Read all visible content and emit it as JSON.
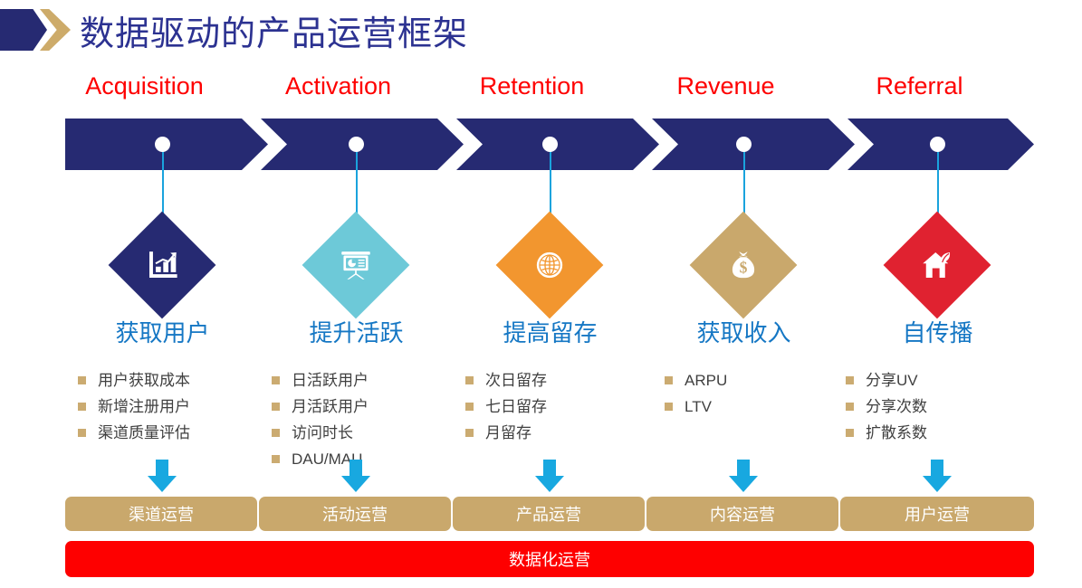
{
  "header": {
    "title": "数据驱动的产品运营框架",
    "logo_icon": "double-chevron-logo"
  },
  "colors": {
    "navy": "#262a72",
    "gold": "#c9a86c",
    "red": "#fe0000",
    "blue_text": "#1577c4",
    "cyan": "#18a8e0",
    "teal": "#6dc9d8",
    "orange": "#f2962f",
    "crimson": "#e02230"
  },
  "stages": [
    {
      "en_label": "Acquisition",
      "cn_label": "获取用户",
      "icon": "bar-chart-growth-icon",
      "diamond_color": "#262a72",
      "metrics": [
        "用户获取成本",
        "新增注册用户",
        "渠道质量评估"
      ],
      "op_box": "渠道运营"
    },
    {
      "en_label": "Activation",
      "cn_label": "提升活跃",
      "icon": "presentation-board-icon",
      "diamond_color": "#6dc9d8",
      "metrics": [
        "日活跃用户",
        "月活跃用户",
        "访问时长",
        "DAU/MAU"
      ],
      "op_box": "活动运营"
    },
    {
      "en_label": "Retention",
      "cn_label": "提高留存",
      "icon": "globe-icon",
      "diamond_color": "#f2962f",
      "metrics": [
        "次日留存",
        "七日留存",
        "月留存"
      ],
      "op_box": "产品运营"
    },
    {
      "en_label": "Revenue",
      "cn_label": "获取收入",
      "icon": "money-bag-icon",
      "diamond_color": "#c9a86c",
      "metrics": [
        "ARPU",
        "LTV"
      ],
      "op_box": "内容运营"
    },
    {
      "en_label": "Referral",
      "cn_label": "自传播",
      "icon": "house-leaf-icon",
      "diamond_color": "#e02230",
      "metrics": [
        "分享UV",
        "分享次数",
        "扩散系数"
      ],
      "op_box": "用户运营"
    }
  ],
  "footer": {
    "label": "数据化运营"
  }
}
